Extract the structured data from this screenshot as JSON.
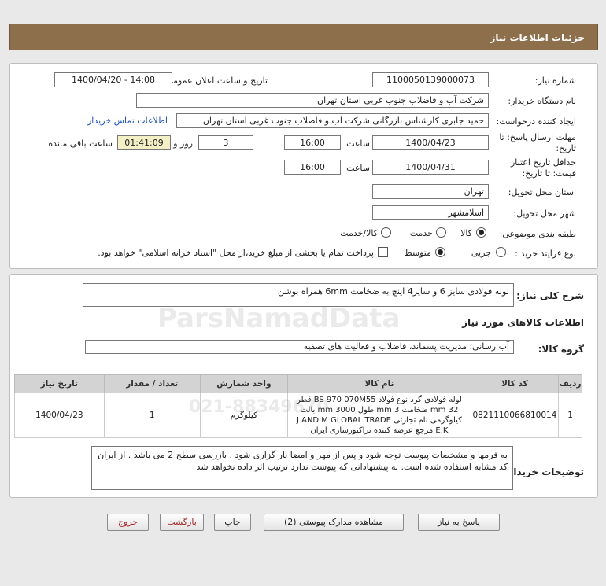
{
  "header": {
    "title": "جزئیات اطلاعات نیاز"
  },
  "fields": {
    "need_number_label": "شماره نیاز:",
    "need_number": "1100050139000073",
    "announce_label": "تاریخ و ساعت اعلان عمومی:",
    "announce_value": "1400/04/20 - 14:08",
    "buyer_org_label": "نام دستگاه خریدار:",
    "buyer_org": "شرکت آب و فاضلاب جنوب غربی استان تهران",
    "requester_label": "ایجاد کننده درخواست:",
    "requester": "حمید  جابری کارشناس بازرگانی شرکت آب و فاضلاب جنوب غربی استان تهران",
    "contact_link": "اطلاعات تماس خریدار",
    "deadline_label_1": "مهلت ارسال پاسخ: تا",
    "deadline_label_2": "تاریخ:",
    "deadline_date": "1400/04/23",
    "hour_label": "ساعت",
    "deadline_time": "16:00",
    "days_value": "3",
    "days_label": "روز و",
    "remaining_time": "01:41:09",
    "remaining_label": "ساعت باقی مانده",
    "validity_label_1": "حداقل تاریخ اعتبار",
    "validity_label_2": "قیمت: تا تاریخ:",
    "validity_date": "1400/04/31",
    "validity_time": "16:00",
    "province_label": "استان محل تحویل:",
    "province": "تهران",
    "city_label": "شهر محل تحویل:",
    "city": "اسلامشهر",
    "category_label": "طبقه بندی موضوعی:",
    "cat_goods": "کالا",
    "cat_service": "خدمت",
    "cat_goods_service": "کالا/خدمت",
    "process_label": "نوع فرآیند خرید :",
    "proc_minor": "جزیی",
    "proc_medium": "متوسط",
    "payment_note": "پرداخت تمام یا بخشی از مبلغ خرید،از محل \"اسناد خزانه اسلامی\" خواهد بود."
  },
  "summary": {
    "label": "شرح کلی نیاز:",
    "value": "لوله فولادی سایز 6 و سایز4 اینچ به ضخامت 6mm همراه بوشن"
  },
  "goods_info": {
    "title": "اطلاعات کالاهای مورد نیاز"
  },
  "goods_group": {
    "label": "گروه کالا:",
    "value": "آب رسانی؛ مدیریت پسماند، فاضلاب و فعالیت های تصفیه"
  },
  "table": {
    "headers": [
      "ردیف",
      "کد کالا",
      "نام کالا",
      "واحد شمارش",
      "تعداد / مقدار",
      "تاریخ نیاز"
    ],
    "rows": [
      {
        "index": "1",
        "code": "0821110066810014",
        "name": "لوله فولادی گرد نوع فولاد BS 970 070M55 قطر 32 mm ضخامت 3 mm طول 3000 mm بالت کیلوگرمی نام تجارتی J AND M GLOBAL TRADE E.K مرجع عرضه کننده تراکتورسازی ایران",
        "unit": "کیلوگرم",
        "qty": "1",
        "date": "1400/04/23"
      }
    ]
  },
  "buyer_notes": {
    "label": "توضیحات خریدار:",
    "value": "به فرمها و مشخصات پیوست توجه شود و پس از مهر و امضا بار گزاری شود . بازرسی سطح 2 می باشد . از ایران کد مشابه استفاده شده است. به پیشنهاداتی که پیوست ندارد ترتیب اثر داده نخواهد شد"
  },
  "buttons": {
    "reply": "پاسخ به نیاز",
    "attachments": "مشاهده مدارک پیوستی (2)",
    "print": "چاپ",
    "back": "بازگشت",
    "exit": "خروج"
  },
  "watermark": {
    "brand": "ParsNamadData",
    "phone": "021-88349670"
  }
}
